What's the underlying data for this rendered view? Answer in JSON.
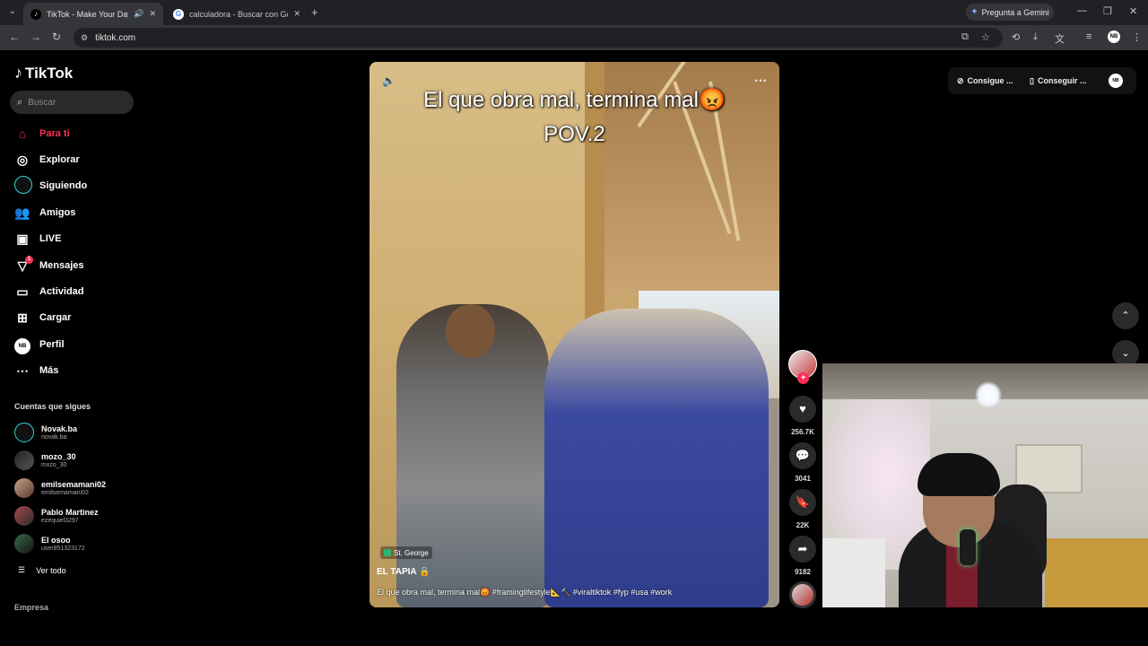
{
  "browser": {
    "tabs": [
      {
        "title": "TikTok - Make Your Day",
        "active": true
      },
      {
        "title": "calculadora - Buscar con Google",
        "active": false
      }
    ],
    "gemini_label": "Pregunta a Gemini",
    "url": "tiktok.com"
  },
  "brand": {
    "name": "TikTok"
  },
  "search": {
    "placeholder": "Buscar"
  },
  "nav": [
    {
      "label": "Para ti",
      "icon": "home-icon",
      "active": true
    },
    {
      "label": "Explorar",
      "icon": "compass-icon"
    },
    {
      "label": "Siguiendo",
      "icon": "following-avatar-icon"
    },
    {
      "label": "Amigos",
      "icon": "friends-icon"
    },
    {
      "label": "LIVE",
      "icon": "live-icon"
    },
    {
      "label": "Mensajes",
      "icon": "messages-icon",
      "badge": "1"
    },
    {
      "label": "Actividad",
      "icon": "activity-icon"
    },
    {
      "label": "Cargar",
      "icon": "upload-icon"
    },
    {
      "label": "Perfil",
      "icon": "profile-icon"
    },
    {
      "label": "Más",
      "icon": "more-icon"
    }
  ],
  "following": {
    "title": "Cuentas que sigues",
    "accounts": [
      {
        "name": "Novak.ba",
        "handle": "novak.ba"
      },
      {
        "name": "mozo_30",
        "handle": "mxzo_30"
      },
      {
        "name": "emilsemamani02",
        "handle": "emilsemamani02"
      },
      {
        "name": "Pablo Martinez",
        "handle": "ezequiel3297"
      },
      {
        "name": "El osoo",
        "handle": "user851323172"
      }
    ],
    "see_all": "Ver todo"
  },
  "footer": {
    "company": "Empresa"
  },
  "video": {
    "caption_line1": "El que obra mal, termina mal😡",
    "caption_line2": "POV.2",
    "location": "St. George",
    "author": "EL TAPIA 🔒",
    "description": "El que obra mal, termina mal😡 #framinglifestyle📐🔨 #viraltiktok #fyp #usa #work"
  },
  "actions": {
    "likes": "256.7K",
    "comments": "3041",
    "saves": "22K",
    "shares": "9182"
  },
  "top_right": {
    "get_coins": "Consigue ...",
    "get_app": "Conseguir ..."
  },
  "colors": {
    "accent": "#fe2c55",
    "background": "#000000"
  }
}
